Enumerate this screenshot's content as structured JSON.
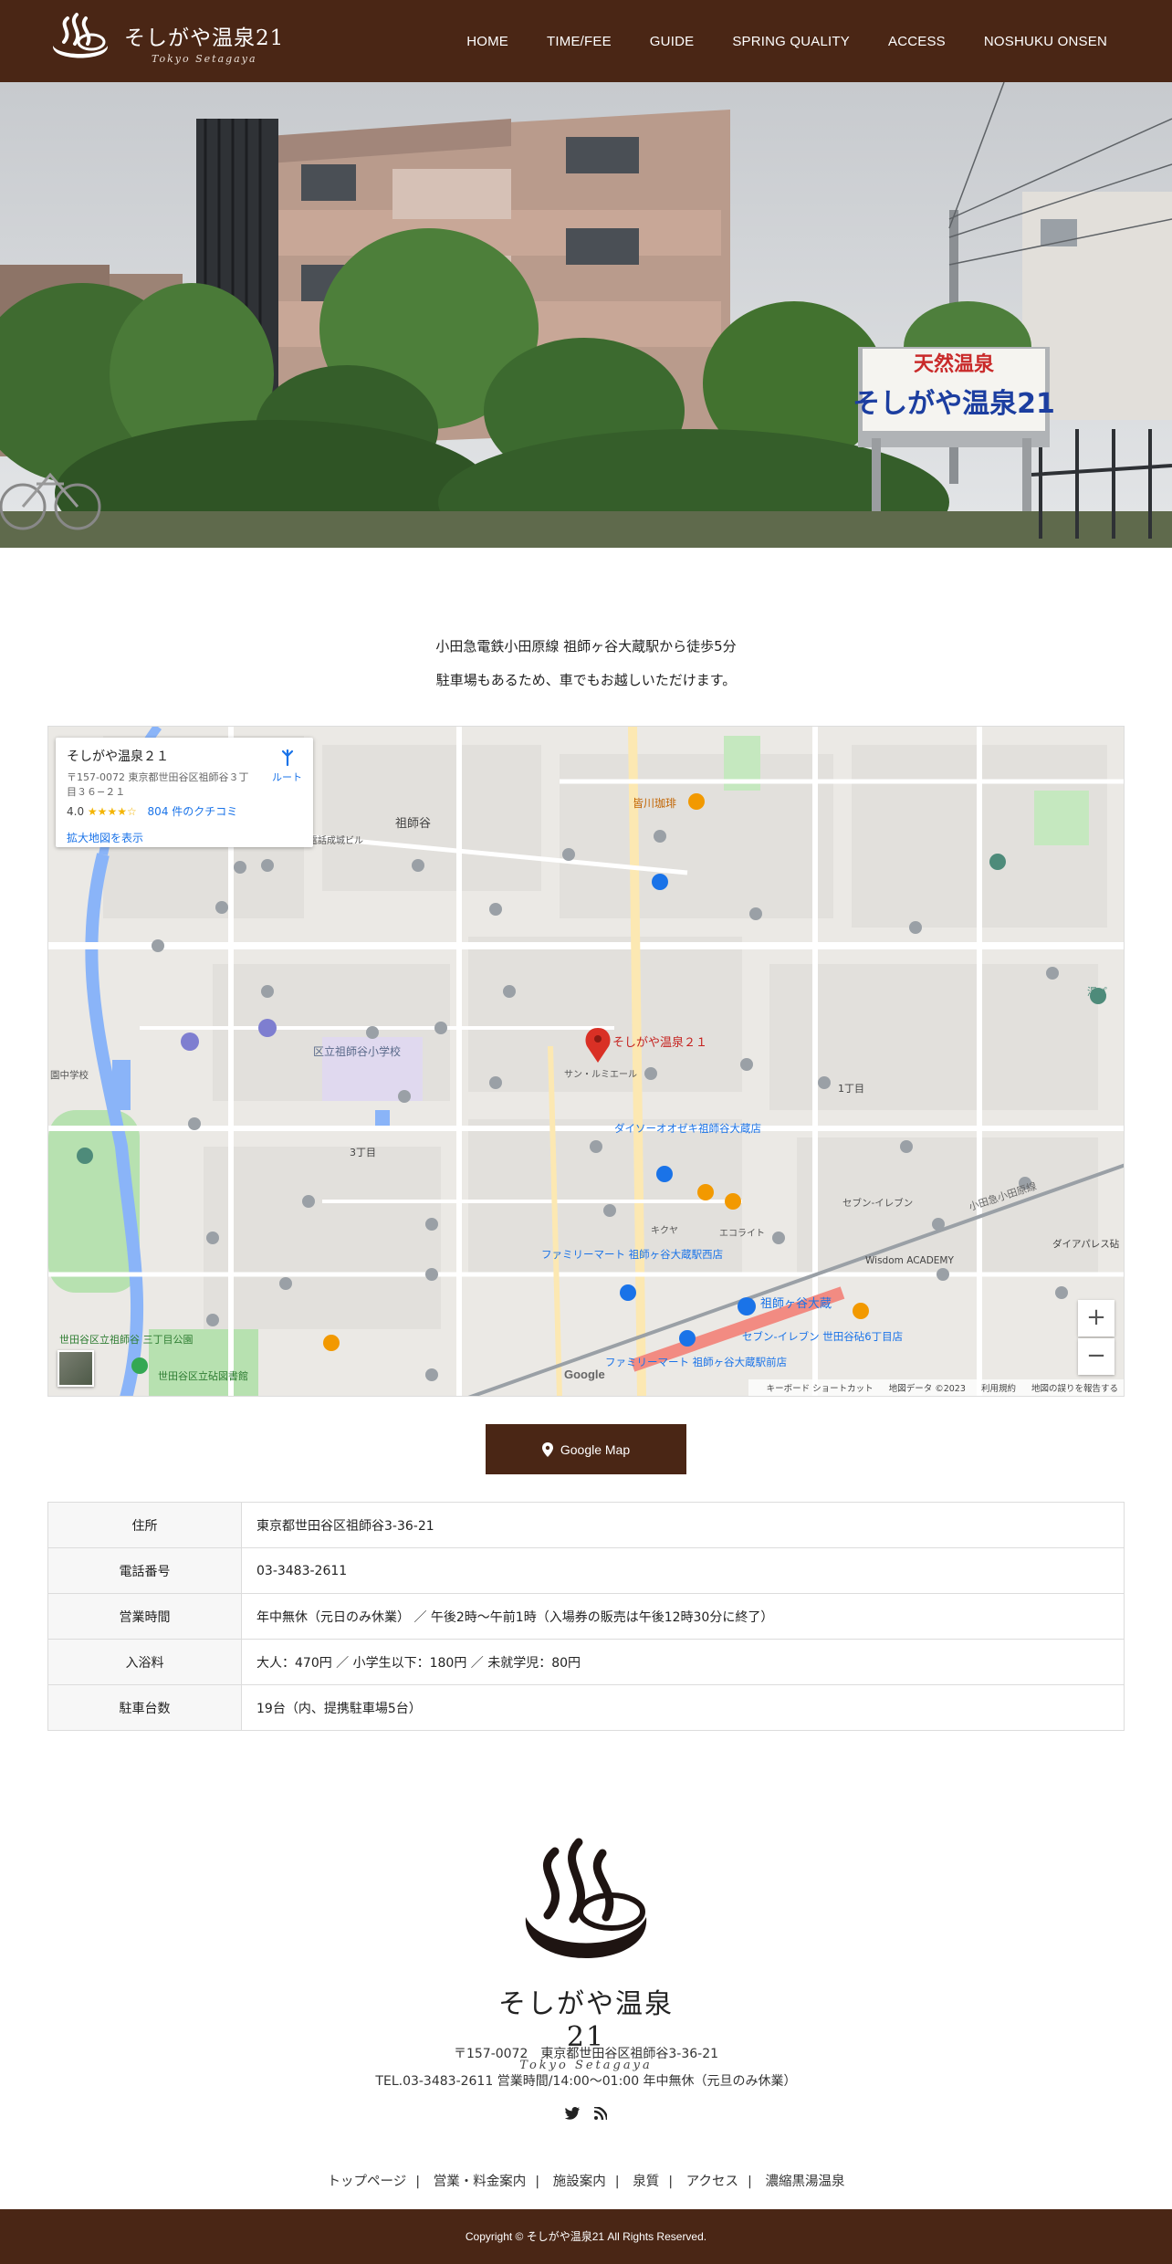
{
  "header": {
    "logo_name": "そしがや温泉21",
    "logo_sub": "Tokyo Setagaya",
    "nav": [
      "HOME",
      "TIME/FEE",
      "GUIDE",
      "SPRING QUALITY",
      "ACCESS",
      "NOSHUKU ONSEN"
    ]
  },
  "hero": {
    "sign_top": "天然温泉",
    "sign_main": "そしがや温泉21"
  },
  "intro": {
    "line1": "小田急電鉄小田原線 祖師ヶ谷大蔵駅から徒歩5分",
    "line2": "駐車場もあるため、車でもお越しいただけます。"
  },
  "map": {
    "card_title": "そしがや温泉２１",
    "card_address": "〒157-0072 東京都世田谷区祖師谷３丁目３６−２１",
    "rating": "4.0",
    "stars": "★★★★☆",
    "reviews": "804 件のクチコミ",
    "enlarge": "拡大地図を表示",
    "route": "ルート",
    "pin_label": "そしがや温泉２１",
    "google": "Google",
    "attr": [
      "キーボード ショートカット",
      "地図データ ©2023",
      "利用規約",
      "地図の誤りを報告する"
    ],
    "labels": {
      "shiso": "祖師谷",
      "kunitachi": "区立祖師谷小学校",
      "daiso": "ダイソーオオゼキ祖師谷大蔵店",
      "station": "祖師ヶ谷大蔵",
      "famima1": "ファミリーマート 祖師ヶ谷大蔵駅西店",
      "famima2": "ファミリーマート 祖師ヶ谷大蔵駅前店",
      "seven": "セブン-イレブン 世田谷砧6丁目店",
      "seven2": "セブン-イレブン",
      "kohi": "皆川珈琲",
      "chome1": "1丁目",
      "chome3": "3丁目",
      "line": "小田急小田原線",
      "park": "世田谷区立祖師谷 三丁目公園",
      "lib": "世田谷区立砧図書館",
      "wisdom": "Wisdom ACADEMY",
      "diapalace": "ダイアパレス砧",
      "nichiden": "日本電信電話成城ビル",
      "chuugakko": "園中学校",
      "yunoken": "湯パ",
      "serpa": "サン・ルミエール",
      "kikuya": "キクヤ",
      "ecolight": "エコライト"
    }
  },
  "button": {
    "label": "Google Map",
    "icon": "map-pin-icon"
  },
  "info": [
    {
      "key": "住所",
      "value": "東京都世田谷区祖師谷3-36-21"
    },
    {
      "key": "電話番号",
      "value": "03-3483-2611"
    },
    {
      "key": "営業時間",
      "value": "年中無休（元日のみ休業） ／ 午後2時～午前1時（入場券の販売は午後12時30分に終了）"
    },
    {
      "key": "入浴料",
      "value": "大人：470円 ／ 小学生以下：180円 ／ 未就学児：80円"
    },
    {
      "key": "駐車台数",
      "value": "19台（内、提携駐車場5台）"
    }
  ],
  "footer": {
    "name": "そしがや温泉21",
    "sub": "Tokyo Setagaya",
    "address": "〒157-0072　東京都世田谷区祖師谷3-36-21",
    "tel": "TEL.03-3483-2611 営業時間/14:00～01:00 年中無休（元旦のみ休業）",
    "links": [
      "トップページ",
      "営業・料金案内",
      "施設案内",
      "泉質",
      "アクセス",
      "濃縮黒湯温泉"
    ],
    "copyright": "Copyright © そしがや温泉21 All Rights Reserved."
  },
  "colors": {
    "brand": "#4a2615",
    "pin": "#d93025",
    "water": "#8ab4f8",
    "park": "#b7e1b0"
  }
}
